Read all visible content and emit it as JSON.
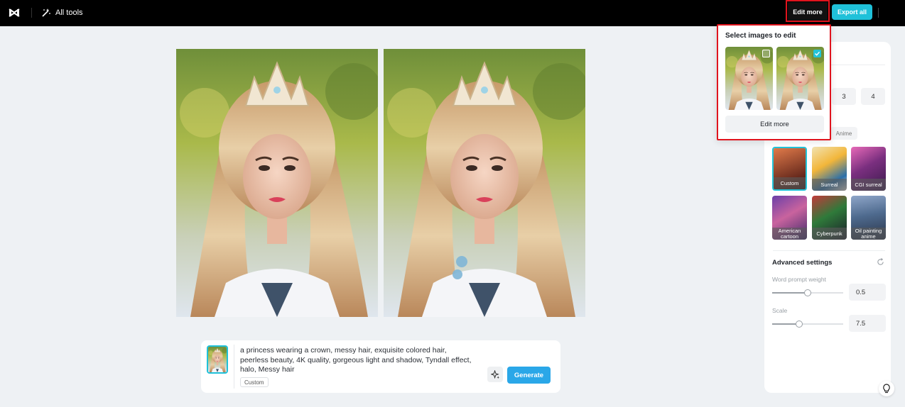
{
  "topbar": {
    "all_tools_label": "All tools",
    "edit_more_label": "Edit more",
    "export_all_label": "Export all"
  },
  "popup": {
    "title": "Select images to edit",
    "images": [
      {
        "checked": false
      },
      {
        "checked": true
      }
    ],
    "button_label": "Edit more"
  },
  "prompt": {
    "text": "a princess wearing a crown,  messy hair, exquisite colored hair, peerless beauty, 4K quality, gorgeous light and shadow, Tyndall effect, halo, Messy hair",
    "tag": "Custom",
    "generate_label": "Generate"
  },
  "right_panel": {
    "ratio_options": [
      "3",
      "4"
    ],
    "style_tab": "Anime",
    "styles": [
      {
        "label": "Custom",
        "selected": true
      },
      {
        "label": "Surreal",
        "selected": false
      },
      {
        "label": "CGI surreal",
        "selected": false
      },
      {
        "label": "American cartoon",
        "selected": false
      },
      {
        "label": "Cyberpunk",
        "selected": false
      },
      {
        "label": "Oil painting anime",
        "selected": false
      }
    ],
    "advanced_title": "Advanced settings",
    "word_prompt_weight": {
      "label": "Word prompt weight",
      "value": "0.5",
      "fraction": 0.5
    },
    "scale": {
      "label": "Scale",
      "value": "7.5",
      "fraction": 0.375
    }
  },
  "colors": {
    "accent": "#1fc1d9",
    "generate": "#2aa7e8",
    "highlight": "#e0141d"
  }
}
